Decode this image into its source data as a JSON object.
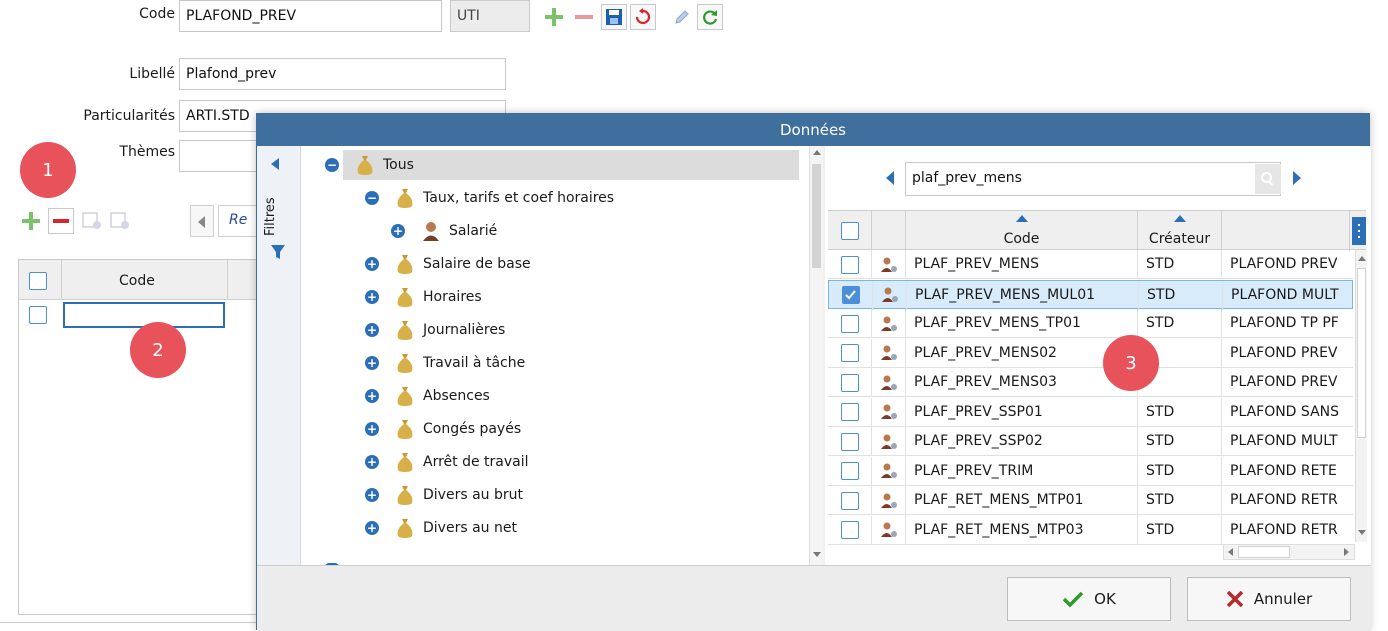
{
  "form": {
    "code_label": "Code",
    "code_value": "PLAFOND_PREV",
    "code_suffix": "UTI",
    "libelle_label": "Libellé",
    "libelle_value": "Plafond_prev",
    "particularites_label": "Particularités",
    "particularites_value": "ARTI.STD",
    "themes_label": "Thèmes",
    "themes_value": ""
  },
  "badges": {
    "one": "1",
    "two": "2",
    "three": "3"
  },
  "left_panel": {
    "truncated_tab": "Re",
    "grid_header_code": "Code"
  },
  "modal": {
    "title": "Données",
    "filters_label": "Filtres",
    "search_value": "plaf_prev_mens",
    "tree": [
      {
        "label": "Tous",
        "level": 0,
        "node": "minus"
      },
      {
        "label": "Taux, tarifs et coef horaires",
        "level": 1,
        "node": "minus"
      },
      {
        "label": "Salarié",
        "level": 2,
        "node": "plus",
        "icon": "person"
      },
      {
        "label": "Salaire de base",
        "level": 1,
        "node": "plus"
      },
      {
        "label": "Horaires",
        "level": 1,
        "node": "plus"
      },
      {
        "label": "Journalières",
        "level": 1,
        "node": "plus"
      },
      {
        "label": "Travail à tâche",
        "level": 1,
        "node": "plus"
      },
      {
        "label": "Absences",
        "level": 1,
        "node": "plus"
      },
      {
        "label": "Congés payés",
        "level": 1,
        "node": "plus"
      },
      {
        "label": "Arrêt de travail",
        "level": 1,
        "node": "plus"
      },
      {
        "label": "Divers au brut",
        "level": 1,
        "node": "plus"
      },
      {
        "label": "Divers au net",
        "level": 1,
        "node": "plus"
      }
    ],
    "columns": {
      "code": "Code",
      "createur": "Créateur"
    },
    "rows": [
      {
        "code": "PLAF_PREV_MENS",
        "createur": "STD",
        "libelle": "PLAFOND PREV",
        "checked": false
      },
      {
        "code": "PLAF_PREV_MENS_MUL01",
        "createur": "STD",
        "libelle": "PLAFOND MULT",
        "checked": true
      },
      {
        "code": "PLAF_PREV_MENS_TP01",
        "createur": "STD",
        "libelle": "PLAFOND TP PF",
        "checked": false
      },
      {
        "code": "PLAF_PREV_MENS02",
        "createur": "",
        "libelle": "PLAFOND PREV",
        "checked": false
      },
      {
        "code": "PLAF_PREV_MENS03",
        "createur": "",
        "libelle": "PLAFOND PREV",
        "checked": false
      },
      {
        "code": "PLAF_PREV_SSP01",
        "createur": "STD",
        "libelle": "PLAFOND SANS",
        "checked": false
      },
      {
        "code": "PLAF_PREV_SSP02",
        "createur": "STD",
        "libelle": "PLAFOND MULT",
        "checked": false
      },
      {
        "code": "PLAF_PREV_TRIM",
        "createur": "STD",
        "libelle": "PLAFOND RETE",
        "checked": false
      },
      {
        "code": "PLAF_RET_MENS_MTP01",
        "createur": "STD",
        "libelle": "PLAFOND RETR",
        "checked": false
      },
      {
        "code": "PLAF_RET_MENS_MTP03",
        "createur": "STD",
        "libelle": "PLAFOND RETR",
        "checked": false
      }
    ],
    "ok_label": "OK",
    "cancel_label": "Annuler"
  },
  "colors": {
    "accent": "#2d6fb7",
    "title_bar": "#3f6f9c",
    "badge": "#e8525b",
    "ok_check": "#2e9a2e",
    "cancel_x": "#c0392b"
  }
}
